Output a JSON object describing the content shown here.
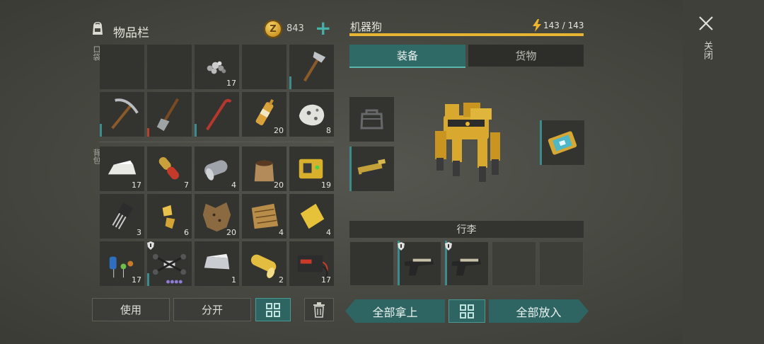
{
  "inventory": {
    "title": "物品栏",
    "coins": "843",
    "pocket_label": "口袋",
    "backpack_label": "背包",
    "slots": [
      {
        "icon": "empty-slot",
        "count": ""
      },
      {
        "icon": "empty-slot",
        "count": ""
      },
      {
        "icon": "gravel-icon",
        "count": "17"
      },
      {
        "icon": "empty-slot",
        "count": ""
      },
      {
        "icon": "hatchet-icon",
        "count": ""
      },
      {
        "icon": "pickaxe-icon",
        "count": ""
      },
      {
        "icon": "shovel-icon",
        "count": ""
      },
      {
        "icon": "crowbar-icon",
        "count": ""
      },
      {
        "icon": "ampoule-icon",
        "count": "20"
      },
      {
        "icon": "ore-icon",
        "count": "8"
      },
      {
        "icon": "ingot-icon",
        "count": "17"
      },
      {
        "icon": "capsule-icon",
        "count": "7"
      },
      {
        "icon": "metal-roll-icon",
        "count": "4"
      },
      {
        "icon": "sack-icon",
        "count": "20"
      },
      {
        "icon": "battery-pack-icon",
        "count": "19"
      },
      {
        "icon": "transistor-icon",
        "count": "3"
      },
      {
        "icon": "gold-pieces-icon",
        "count": "6"
      },
      {
        "icon": "hide-icon",
        "count": "20"
      },
      {
        "icon": "snake-skin-icon",
        "count": "4"
      },
      {
        "icon": "yellow-cloth-icon",
        "count": "4"
      },
      {
        "icon": "electronics-icon",
        "count": "17"
      },
      {
        "icon": "drone-icon",
        "count": ""
      },
      {
        "icon": "metal-bar-icon",
        "count": "1"
      },
      {
        "icon": "yellow-roll-icon",
        "count": "2"
      },
      {
        "icon": "car-battery-icon",
        "count": "17"
      }
    ],
    "use_button": "使用",
    "split_button": "分开"
  },
  "robot": {
    "name": "机器狗",
    "hp_text": "143 / 143",
    "hp_fraction": 1.0,
    "tab_equipment": "装备",
    "tab_cargo": "货物",
    "luggage_label": "行李",
    "take_all": "全部拿上",
    "put_all": "全部放入"
  },
  "close_label": "关闭",
  "colors": {
    "accent": "#2e6562",
    "hp": "#e7b531",
    "panel": "#33342f"
  }
}
